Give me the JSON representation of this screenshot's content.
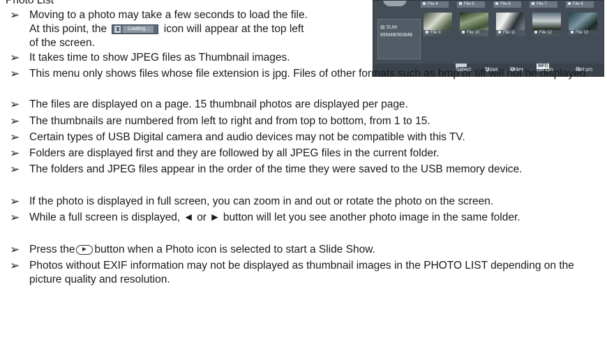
{
  "heading": "Photo List",
  "notes": [
    {
      "line1_pre": "Moving to a photo may take a few seconds to load the file.",
      "line2_pre": "At this point, the",
      "loading_label": "Loading...",
      "line2_post": "icon will appear at the top left",
      "line3": "of the screen."
    },
    {
      "text": "It takes time to show JPEG files as Thumbnail images."
    },
    {
      "text": "This menu only shows files whose file extension is jpg. Files of other formats such as bmp or tiff will not be displayed."
    },
    {
      "text": "The files are displayed on a page. 15 thumbnail photos are displayed per page."
    },
    {
      "text": "The thumbnails are numbered from left to right and from top to bottom, from 1 to 15."
    },
    {
      "text": "Certain types of USB Digital camera and audio devices may not be compatible with this TV."
    },
    {
      "text": "Folders are displayed first and they are followed by all JPEG files in the current folder."
    },
    {
      "text": "The folders and JPEG files appear in the order of the time they were saved to the USB memory device."
    },
    {
      "text": "If the photo is displayed in full screen, you can zoom in and out or rotate the photo on the screen."
    },
    {
      "text": "While a full screen is displayed, ◄ or ► button will let you see another photo image in the same folder."
    },
    {
      "pre": "Press the",
      "post": "button when a Photo icon is selected to start a Slide Show."
    },
    {
      "text": "Photos without EXIF information may not be displayed as thumbnail images in the PHOTO LIST depending on the picture quality and resolution."
    }
  ],
  "tv_screen": {
    "device_label": "SUM",
    "capacity": "895MB/993MB",
    "top_labels": [
      "File 4",
      "File 5",
      "File 6",
      "File 7",
      "File 8"
    ],
    "thumb_labels": [
      "File 9",
      "File 10",
      "File 11",
      "File 12",
      "File 13"
    ],
    "controls": {
      "select": "Select",
      "move": "Move",
      "enter": "Enter",
      "info_key": "INFO",
      "option": "Option",
      "return": "Return"
    }
  }
}
